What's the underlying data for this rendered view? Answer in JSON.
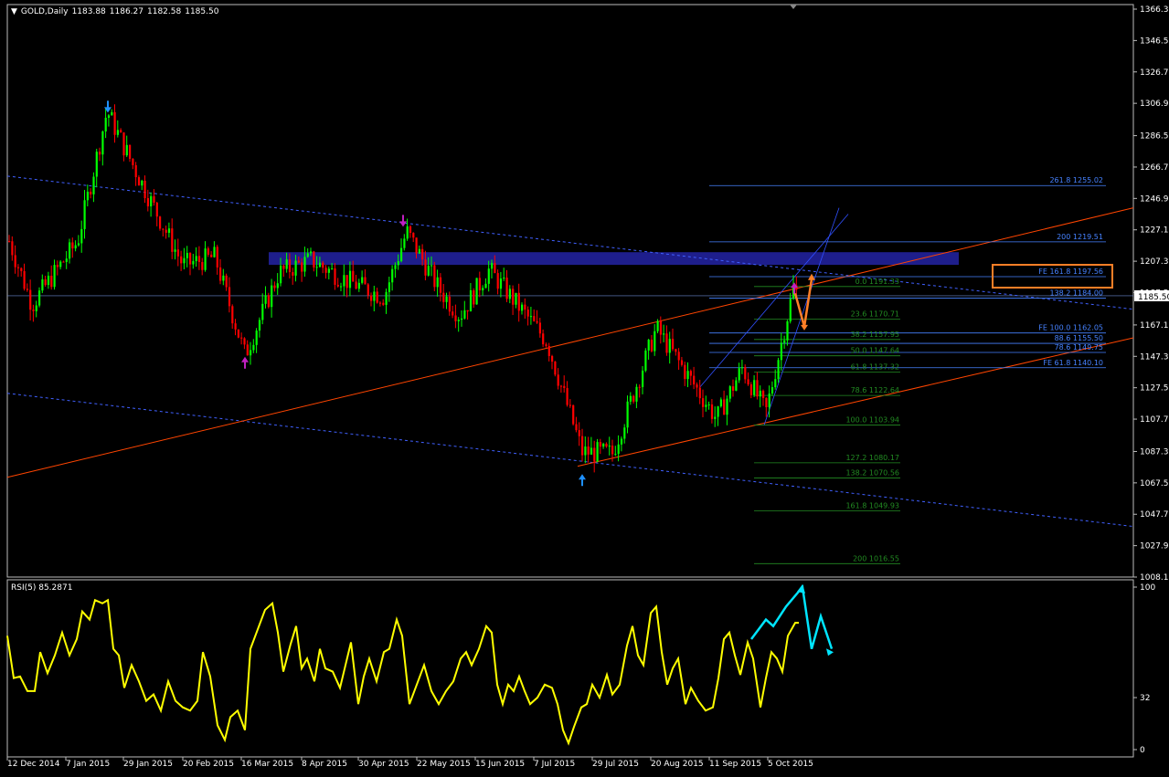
{
  "header": {
    "symbol_timeframe": "GOLD,Daily",
    "ohlc": [
      "1183.88",
      "1186.27",
      "1182.58",
      "1185.50"
    ]
  },
  "price_axis": {
    "ticks": [
      "1366.30",
      "1346.50",
      "1326.70",
      "1306.90",
      "1286.50",
      "1266.70",
      "1246.90",
      "1227.10",
      "1207.30",
      "1187.50",
      "1167.10",
      "1147.30",
      "1127.50",
      "1107.70",
      "1087.30",
      "1067.50",
      "1047.70",
      "1027.90",
      "1008.10"
    ],
    "current_price_label": "1185.50"
  },
  "date_axis": {
    "labels": [
      "12 Dec 2014",
      "7 Jan 2015",
      "29 Jan 2015",
      "20 Feb 2015",
      "16 Mar 2015",
      "8 Apr 2015",
      "30 Apr 2015",
      "22 May 2015",
      "15 Jun 2015",
      "7 Jul 2015",
      "29 Jul 2015",
      "20 Aug 2015",
      "11 Sep 2015",
      "5 Oct 2015"
    ]
  },
  "fib_retracement": [
    {
      "label": "0.0  1191.33"
    },
    {
      "label": "23.6  1170.71"
    },
    {
      "label": "38.2  1157.95"
    },
    {
      "label": "50.0  1147.64"
    },
    {
      "label": "61.8  1137.32"
    },
    {
      "label": "78.6  1122.64"
    },
    {
      "label": "100.0  1103.94"
    },
    {
      "label": "127.2  1080.17"
    },
    {
      "label": "138.2  1070.56"
    },
    {
      "label": "161.8  1049.93"
    },
    {
      "label": "200  1016.55"
    }
  ],
  "fib_expansion": [
    {
      "label": "261.8  1255.02"
    },
    {
      "label": "200  1219.51"
    },
    {
      "label": "FE 161.8  1197.56",
      "highlighted": true
    },
    {
      "label": "138.2  1184.00"
    },
    {
      "label": "FE 100.0  1162.05"
    },
    {
      "label": "88.6  1155.50"
    },
    {
      "label": "78.6  1149.75"
    },
    {
      "label": "FE 61.8  1140.10"
    }
  ],
  "rsi": {
    "label": "RSI(5) 85.2871",
    "axis_ticks": [
      "100",
      "32",
      "0"
    ]
  },
  "chart_data": {
    "type": "candlestick",
    "instrument": "GOLD",
    "timeframe": "Daily",
    "last_bar": {
      "open": 1183.88,
      "high": 1186.27,
      "low": 1182.58,
      "close": 1185.5
    },
    "ylim": [
      1008.1,
      1366.3
    ],
    "approx_swing_points": [
      {
        "date": "12 Dec 2014",
        "close": 1220
      },
      {
        "date": "24 Dec 2014",
        "close": 1180
      },
      {
        "date": "7 Jan 2015",
        "close": 1220
      },
      {
        "date": "22 Jan 2015",
        "close": 1302
      },
      {
        "date": "5 Feb 2015",
        "close": 1260
      },
      {
        "date": "20 Feb 2015",
        "close": 1205
      },
      {
        "date": "2 Mar 2015",
        "close": 1210
      },
      {
        "date": "17 Mar 2015",
        "close": 1148
      },
      {
        "date": "27 Mar 2015",
        "close": 1200
      },
      {
        "date": "8 Apr 2015",
        "close": 1208
      },
      {
        "date": "20 Apr 2015",
        "close": 1195
      },
      {
        "date": "30 Apr 2015",
        "close": 1185
      },
      {
        "date": "18 May 2015",
        "close": 1226
      },
      {
        "date": "1 Jun 2015",
        "close": 1190
      },
      {
        "date": "5 Jun 2015",
        "close": 1173
      },
      {
        "date": "18 Jun 2015",
        "close": 1202
      },
      {
        "date": "7 Jul 2015",
        "close": 1157
      },
      {
        "date": "24 Jul 2015",
        "close": 1087
      },
      {
        "date": "3 Aug 2015",
        "close": 1086
      },
      {
        "date": "24 Aug 2015",
        "close": 1165
      },
      {
        "date": "11 Sep 2015",
        "close": 1108
      },
      {
        "date": "18 Sep 2015",
        "close": 1140
      },
      {
        "date": "1 Oct 2015",
        "close": 1112
      },
      {
        "date": "14 Oct 2015",
        "close": 1190
      },
      {
        "date": "16 Oct 2015",
        "close": 1185.5
      }
    ],
    "rsi_period": 5,
    "rsi_value": 85.2871,
    "rsi_ylim": [
      0,
      100
    ],
    "colors": {
      "bull": "#00ff00",
      "bear": "#ff0000",
      "rsi": "#ffff00",
      "trend": "#ff4500",
      "zone": "#1e1e8c",
      "fib": "#4682ff",
      "retrace": "#228b22",
      "projection_arrow": "#00e5ff",
      "highlight_box": "#ff7f27"
    }
  }
}
